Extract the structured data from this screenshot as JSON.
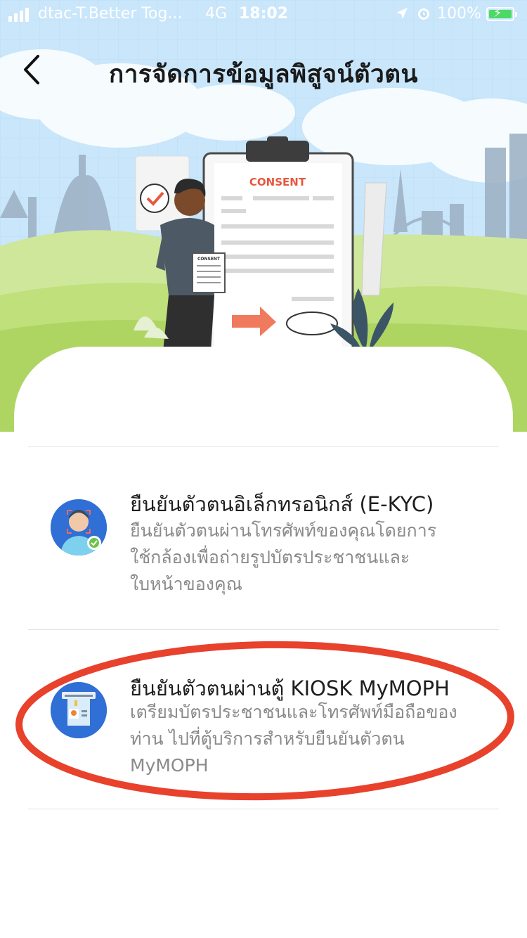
{
  "status_bar": {
    "carrier": "dtac-T.Better Tog...",
    "network": "4G",
    "time": "18:02",
    "battery": "100%",
    "battery_level": 1.0,
    "icons": [
      "signal-icon",
      "location-arrow-icon",
      "alarm-icon",
      "battery-charging-icon"
    ]
  },
  "header": {
    "title": "การจัดการข้อมูลพิสูจน์ตัวตน",
    "back_icon": "chevron-left-icon"
  },
  "hero": {
    "consent_label": "CONSENT",
    "small_consent_label": "CONSENT"
  },
  "options": [
    {
      "title": "ยืนยันตัวตนอิเล็กทรอนิกส์ (E-KYC)",
      "desc_lines": [
        "ยืนยันตัวตนผ่านโทรศัพท์ของคุณโดยการ",
        "ใช้กล้องเพื่อถ่ายรูปบัตรประชาชนและ",
        "ใบหน้าของคุณ"
      ],
      "icon": "face-scan-icon"
    },
    {
      "title": "ยืนยันตัวตนผ่านตู้ KIOSK MyMOPH",
      "desc_lines": [
        "เตรียมบัตรประชาชนและโทรศัพท์มือถือของ",
        "ท่าน ไปที่ตู้บริการสำหรับยืนยันตัวตน",
        "MyMOPH"
      ],
      "icon": "id-card-kiosk-icon"
    }
  ],
  "colors": {
    "sky": "#c9e6fb",
    "grass": "#bfe07a",
    "accent_blue": "#2f6fd6",
    "highlight_red": "#e8412c",
    "consent_red": "#e8573f"
  }
}
